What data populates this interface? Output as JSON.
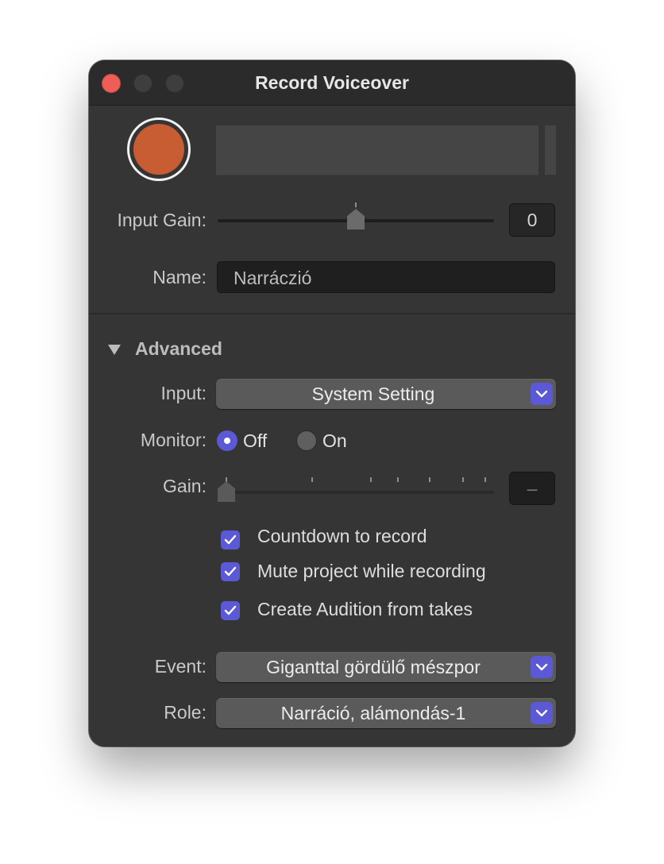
{
  "window": {
    "title": "Record Voiceover"
  },
  "input_gain": {
    "label": "Input Gain:",
    "value": "0",
    "level": 0.5
  },
  "name_field": {
    "label": "Name:",
    "value": "Narráczió"
  },
  "advanced": {
    "label": "Advanced",
    "expanded": true,
    "input": {
      "label": "Input:",
      "selected": "System Setting"
    },
    "monitor": {
      "label": "Monitor:",
      "options": [
        "Off",
        "On"
      ],
      "selected": "Off"
    },
    "gain": {
      "label": "Gain:",
      "value": "–",
      "level": 0,
      "enabled": false
    },
    "checkboxes": [
      {
        "label": "Countdown to record",
        "checked": true
      },
      {
        "label": "Mute project while recording",
        "checked": true
      },
      {
        "label": "Create Audition from takes",
        "checked": true
      }
    ],
    "event": {
      "label": "Event:",
      "selected": "Giganttal gördülő mészpor"
    },
    "role": {
      "label": "Role:",
      "selected": "Narráció, alámondás-1"
    }
  },
  "colors": {
    "window_bg": "#353535",
    "titlebar_bg": "#2b2b2b",
    "record_button": "#c85c33",
    "accent": "#5b59d6",
    "close_button": "#ee5e58"
  }
}
